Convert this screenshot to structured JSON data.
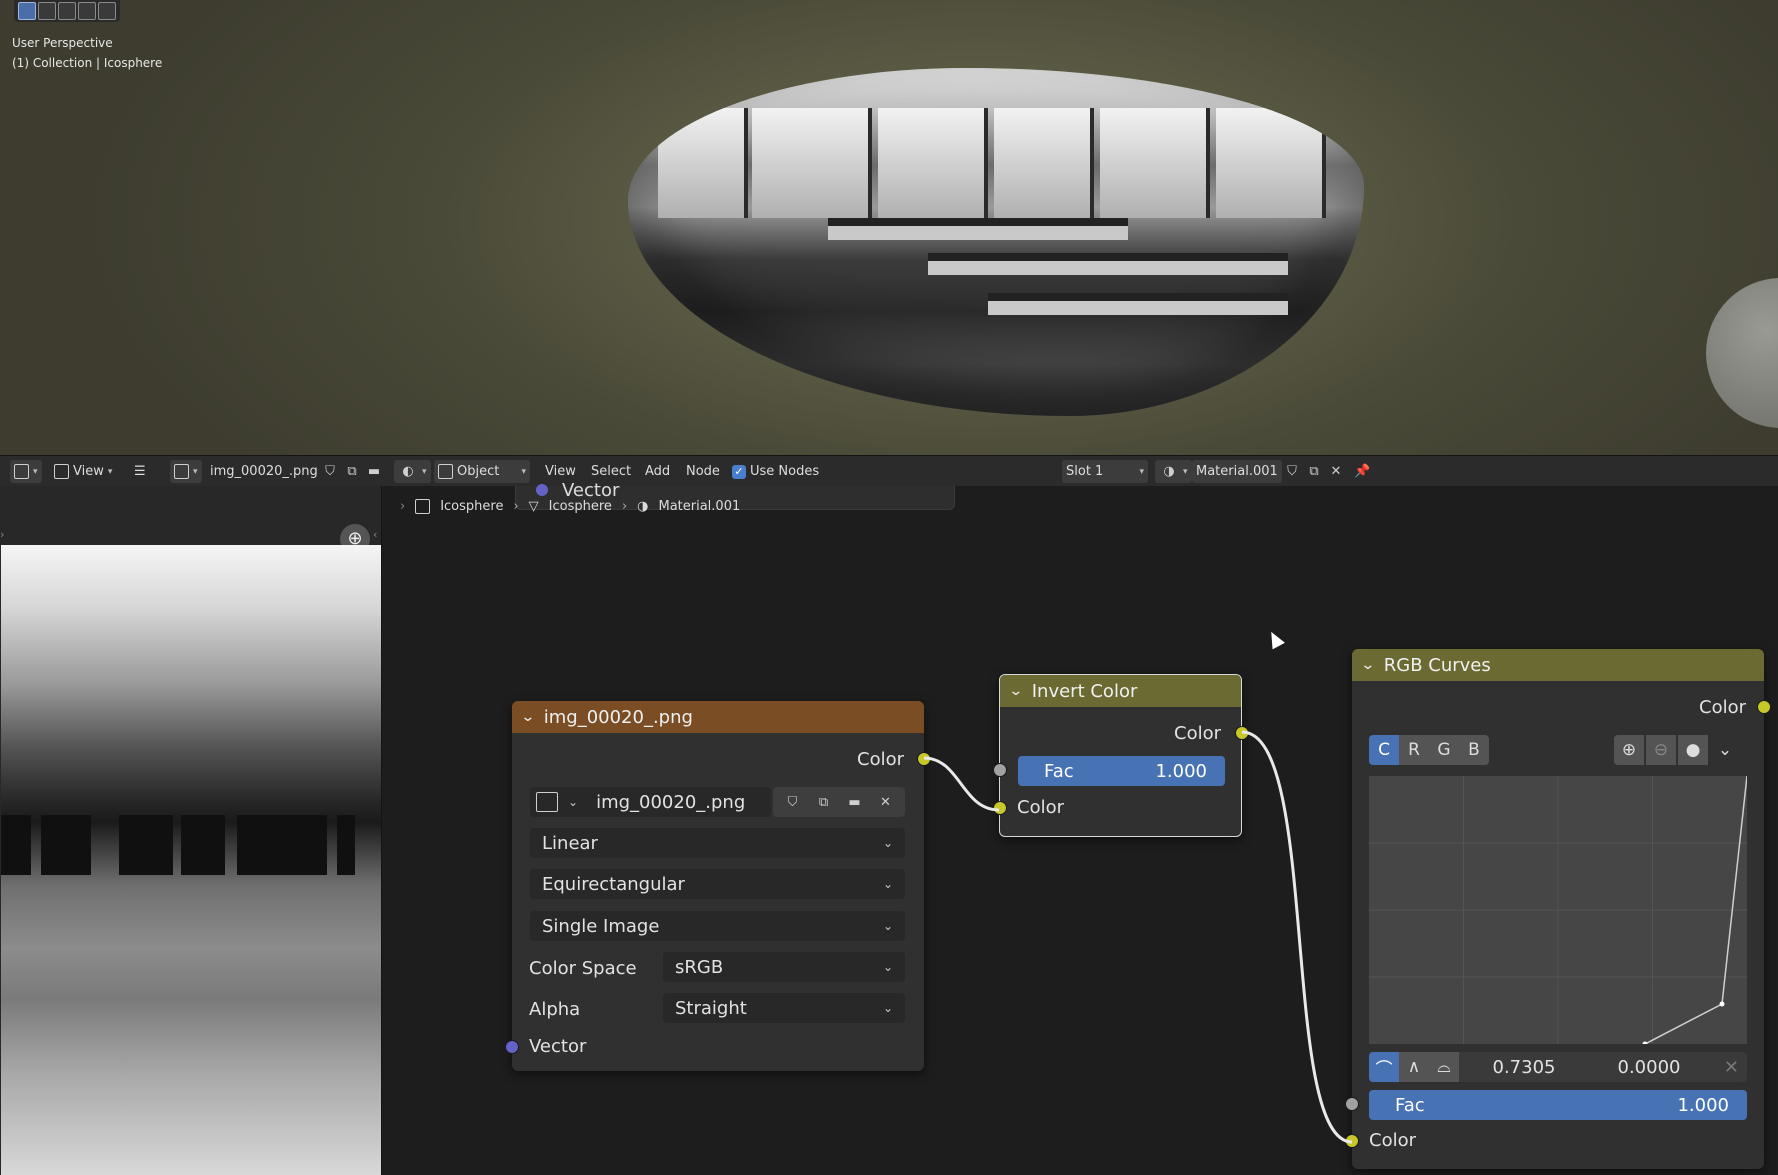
{
  "viewport": {
    "perspective_label": "User Perspective",
    "collection_label": "(1) Collection | Icosphere"
  },
  "header": {
    "image_editor": {
      "view_menu": "View",
      "image_name": "img_00020_.png"
    },
    "node_editor": {
      "object_mode": "Object",
      "menus": [
        "View",
        "Select",
        "Add",
        "Node"
      ],
      "use_nodes_label": "Use Nodes",
      "use_nodes_checked": true,
      "slot": "Slot 1",
      "material": "Material.001"
    }
  },
  "breadcrumb": [
    "Icosphere",
    "Icosphere",
    "Material.001"
  ],
  "ghost_node_label": "Vector",
  "nodes": {
    "image_texture": {
      "title": "img_00020_.png",
      "output_color": "Color",
      "image_name": "img_00020_.png",
      "interpolation": "Linear",
      "projection": "Equirectangular",
      "source": "Single Image",
      "color_space_label": "Color Space",
      "color_space": "sRGB",
      "alpha_label": "Alpha",
      "alpha": "Straight",
      "input_vector": "Vector",
      "header_color": "#7a4d25"
    },
    "invert_color": {
      "title": "Invert Color",
      "output_color": "Color",
      "fac_label": "Fac",
      "fac_value": "1.000",
      "input_color": "Color",
      "header_color": "#6b6a32"
    },
    "rgb_curves": {
      "title": "RGB Curves",
      "output_color": "Color",
      "channels": [
        "C",
        "R",
        "G",
        "B"
      ],
      "active_channel": "C",
      "point_x": "0.7305",
      "point_y": "0.0000",
      "fac_label": "Fac",
      "fac_value": "1.000",
      "input_color": "Color",
      "header_color": "#6b6a32"
    }
  },
  "colors": {
    "socket_color": "#c7c729",
    "socket_float": "#a1a1a1",
    "socket_vector": "#6363c7",
    "slider_blue": "#4772b3"
  }
}
